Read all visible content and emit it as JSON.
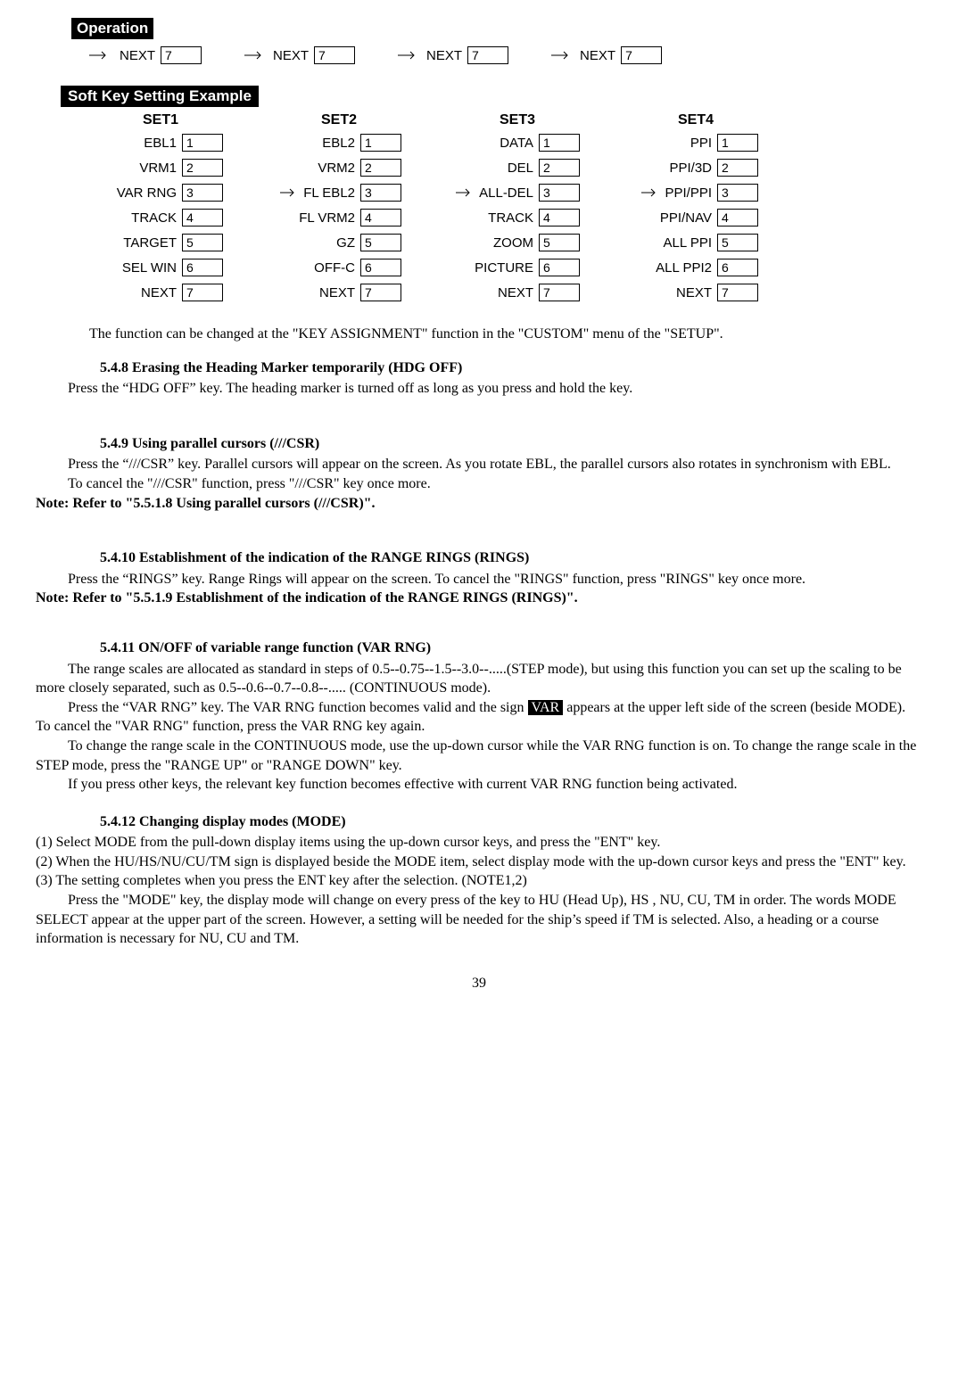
{
  "operation_tag": "Operation",
  "top_row": [
    {
      "label": "NEXT",
      "num": "7"
    },
    {
      "label": "NEXT",
      "num": "7"
    },
    {
      "label": "NEXT",
      "num": "7"
    },
    {
      "label": "NEXT",
      "num": "7"
    }
  ],
  "softkey_tag": "Soft Key Setting Example",
  "sets": [
    {
      "header": "SET1",
      "rows": [
        {
          "label": "EBL1",
          "num": "1"
        },
        {
          "label": "VRM1",
          "num": "2"
        },
        {
          "label": "VAR RNG",
          "num": "3"
        },
        {
          "label": "TRACK",
          "num": "4"
        },
        {
          "label": "TARGET",
          "num": "5"
        },
        {
          "label": "SEL WIN",
          "num": "6"
        },
        {
          "label": "NEXT",
          "num": "7"
        }
      ]
    },
    {
      "header": "SET2",
      "rows": [
        {
          "label": "EBL2",
          "num": "1"
        },
        {
          "label": "VRM2",
          "num": "2"
        },
        {
          "label": "FL EBL2",
          "num": "3"
        },
        {
          "label": "FL VRM2",
          "num": "4"
        },
        {
          "label": "GZ",
          "num": "5"
        },
        {
          "label": "OFF-C",
          "num": "6"
        },
        {
          "label": "NEXT",
          "num": "7"
        }
      ]
    },
    {
      "header": "SET3",
      "rows": [
        {
          "label": "DATA",
          "num": "1"
        },
        {
          "label": "DEL",
          "num": "2"
        },
        {
          "label": "ALL-DEL",
          "num": "3"
        },
        {
          "label": "TRACK",
          "num": "4"
        },
        {
          "label": "ZOOM",
          "num": "5"
        },
        {
          "label": "PICTURE",
          "num": "6"
        },
        {
          "label": "NEXT",
          "num": "7"
        }
      ]
    },
    {
      "header": "SET4",
      "rows": [
        {
          "label": "PPI",
          "num": "1"
        },
        {
          "label": "PPI/3D",
          "num": "2"
        },
        {
          "label": "PPI/PPI",
          "num": "3"
        },
        {
          "label": "PPI/NAV",
          "num": "4"
        },
        {
          "label": "ALL PPI",
          "num": "5"
        },
        {
          "label": "ALL PPI2",
          "num": "6"
        },
        {
          "label": "NEXT",
          "num": "7"
        }
      ]
    }
  ],
  "first_note": "The function can be changed at the \"KEY ASSIGNMENT\" function in the \"CUSTOM\" menu of the \"SETUP\".",
  "s548": {
    "title": "5.4.8 Erasing the Heading Marker temporarily (HDG OFF)",
    "body": "Press the “HDG OFF” key. The heading marker is turned off as long as you press and hold the key."
  },
  "s549": {
    "title": "5.4.9 Using parallel cursors (///CSR)",
    "p1": "Press the “///CSR” key. Parallel cursors will appear on the screen. As you rotate EBL, the parallel cursors also rotates in synchronism with EBL.",
    "p2": "To cancel the \"///CSR\" function, press \"///CSR\" key once more.",
    "note": "Note: Refer to \"5.5.1.8 Using parallel cursors (///CSR)\"."
  },
  "s5410": {
    "title": "5.4.10 Establishment of the indication of the RANGE RINGS (RINGS)",
    "p1": "Press the “RINGS” key. Range Rings will appear on the screen. To cancel the \"RINGS\" function, press \"RINGS\" key once more.",
    "note": "Note: Refer to \"5.5.1.9 Establishment of the indication of the RANGE RINGS (RINGS)\"."
  },
  "s5411": {
    "title": "5.4.11 ON/OFF of variable range function (VAR RNG)",
    "p1": "The range scales are allocated as standard in steps of 0.5--0.75--1.5--3.0--.....(STEP mode), but using this function you can set up the scaling to be more closely separated, such as 0.5--0.6--0.7--0.8--..... (CONTINUOUS mode).",
    "p2a": "Press the “VAR RNG” key. The VAR RNG function becomes valid and the sign ",
    "var_badge": "VAR",
    "p2b": "  appears at the upper left side of the screen (beside MODE). To cancel the \"VAR RNG\" function, press the  VAR RNG key again.",
    "p3": "To change the range scale in the CONTINUOUS mode, use the up-down cursor while the VAR RNG function is on. To change the range scale in the STEP mode, press the \"RANGE UP\" or \"RANGE DOWN\" key.",
    "p4": "If you press other keys, the relevant key function becomes effective with current VAR RNG function being activated."
  },
  "s5412": {
    "title": "5.4.12 Changing display modes (MODE)",
    "li1": "(1)  Select MODE from the pull-down display items using the up-down cursor keys, and press the \"ENT\" key.",
    "li2": "(2)  When the HU/HS/NU/CU/TM sign is displayed beside the MODE item, select display mode with the up-down cursor keys and press the \"ENT\" key.",
    "li3": "(3)  The setting completes when you press the ENT key after the selection.  (NOTE1,2)",
    "p1": "Press the \"MODE\" key, the display mode will change on every press of the key to HU (Head Up), HS , NU, CU, TM in order. The words MODE SELECT appear at the upper part of the screen. However, a setting will be needed for the ship’s speed if TM is selected. Also, a heading or a course information is necessary for NU, CU and TM."
  },
  "page_number": "39"
}
